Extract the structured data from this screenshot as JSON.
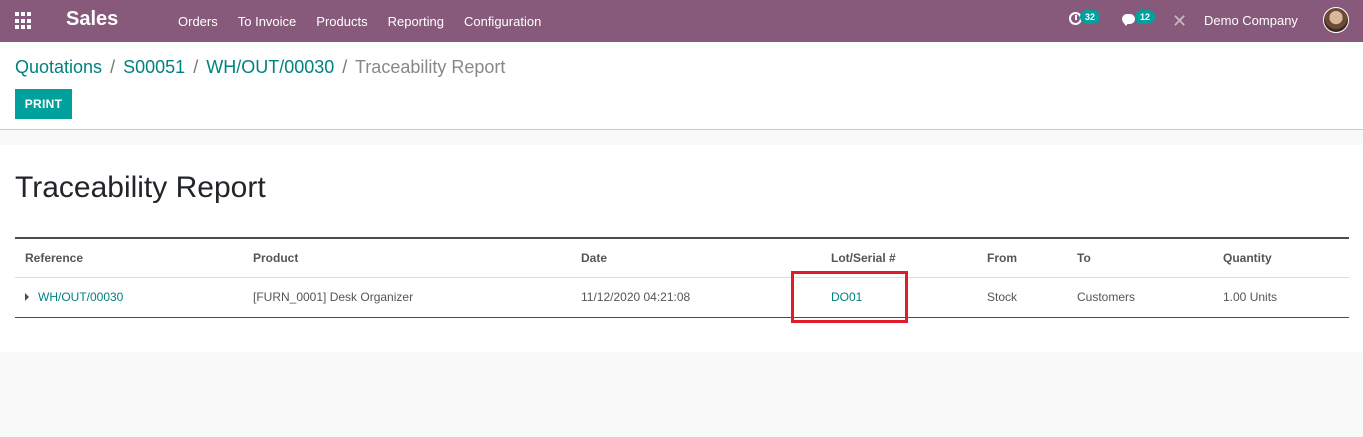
{
  "navbar": {
    "app_name": "Sales",
    "menu": [
      {
        "label": "Orders"
      },
      {
        "label": "To Invoice"
      },
      {
        "label": "Products"
      },
      {
        "label": "Reporting"
      },
      {
        "label": "Configuration"
      }
    ],
    "activity_count": "32",
    "message_count": "12",
    "close_glyph": "✕",
    "company": "Demo Company"
  },
  "breadcrumb": {
    "items": [
      "Quotations",
      "S00051",
      "WH/OUT/00030"
    ],
    "separator": "/",
    "current": "Traceability Report"
  },
  "toolbar": {
    "print_label": "PRINT"
  },
  "report": {
    "title": "Traceability Report",
    "columns": [
      "Reference",
      "Product",
      "Date",
      "Lot/Serial #",
      "From",
      "To",
      "Quantity"
    ],
    "rows": [
      {
        "reference": "WH/OUT/00030",
        "product": "[FURN_0001] Desk Organizer",
        "date": "11/12/2020 04:21:08",
        "lot": "DO01",
        "from": "Stock",
        "to": "Customers",
        "quantity": "1.00 Units"
      }
    ]
  },
  "colors": {
    "navbar": "#875a7b",
    "primary": "#00a09d",
    "link": "#00827f",
    "highlight": "#e21b2b"
  },
  "icons": [
    "apps-grid-icon",
    "activity-clock-icon",
    "chat-icon",
    "close-icon",
    "user-avatar",
    "expand-caret-icon"
  ]
}
